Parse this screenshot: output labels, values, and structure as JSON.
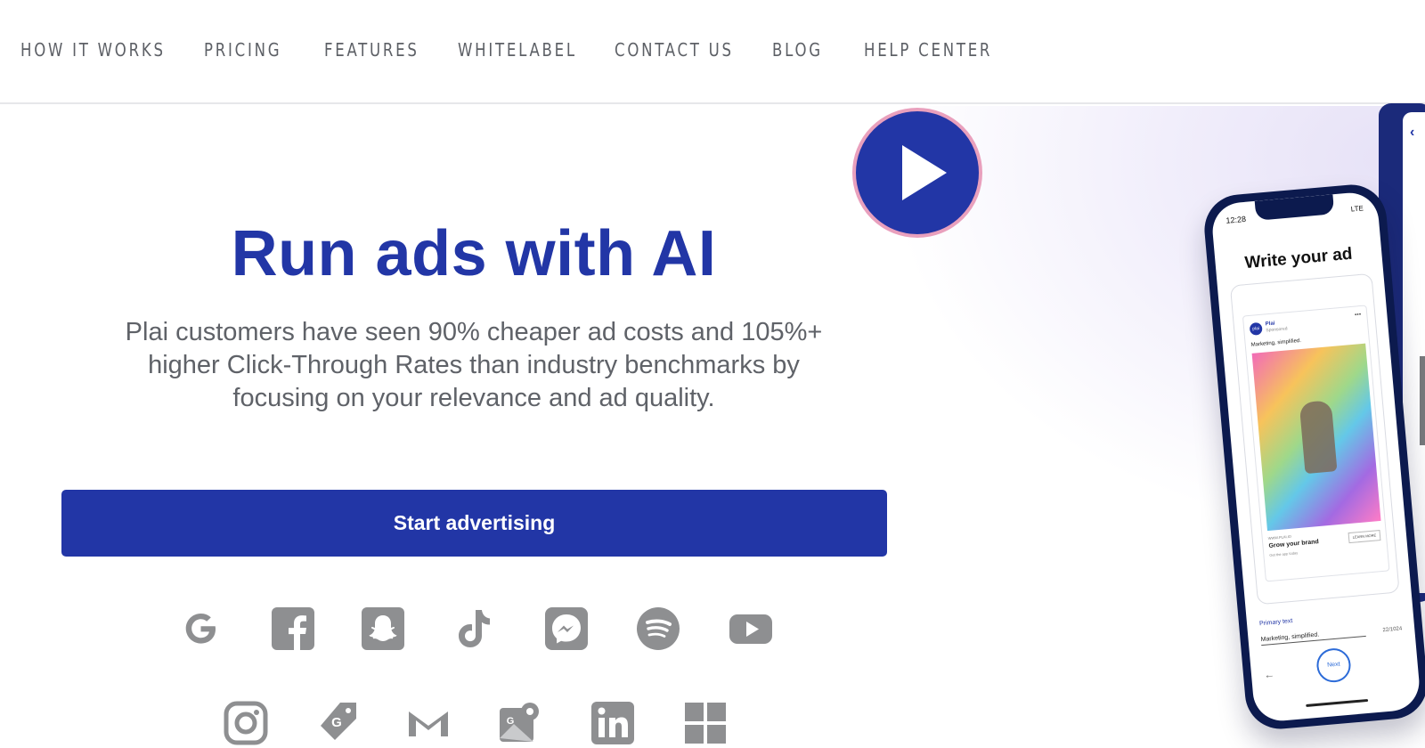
{
  "nav": {
    "items": [
      {
        "label": "HOW IT WORKS"
      },
      {
        "label": "PRICING"
      },
      {
        "label": "FEATURES"
      },
      {
        "label": "WHITELABEL"
      },
      {
        "label": "CONTACT US"
      },
      {
        "label": "BLOG"
      },
      {
        "label": "HELP CENTER"
      }
    ]
  },
  "hero": {
    "title": "Run ads with AI",
    "subtitle_lines": [
      "Plai customers have seen 90% cheaper ad costs and 105%+",
      "higher Click-Through Rates than industry benchmarks by",
      "focusing on your relevance and ad quality."
    ],
    "cta_label": "Start advertising"
  },
  "platform_icons": {
    "row1": [
      "google-icon",
      "facebook-icon",
      "snapchat-icon",
      "tiktok-icon",
      "messenger-icon",
      "spotify-icon",
      "youtube-icon"
    ],
    "row2": [
      "instagram-icon",
      "google-ads-tag-icon",
      "gmail-icon",
      "google-maps-icon",
      "linkedin-icon",
      "microsoft-icon"
    ]
  },
  "phone": {
    "time": "12:28",
    "status": "LTE",
    "title": "Write your ad",
    "ad": {
      "brand": "Plai",
      "sponsored": "Sponsored",
      "caption": "Marketing, simplified.",
      "url": "WWW.PLAI.IO",
      "headline": "Grow your brand",
      "subtext": "Get the app today",
      "cta": "LEARN MORE"
    },
    "primary_text_label": "Primary text",
    "primary_text_value": "Marketing, simplified.",
    "char_count": "22/1024",
    "next_label": "Next"
  },
  "colors": {
    "brand_blue": "#2236a6",
    "play_border": "#e9a0bd",
    "icon_gray": "#8e8f91",
    "nav_text": "#5d6066"
  }
}
